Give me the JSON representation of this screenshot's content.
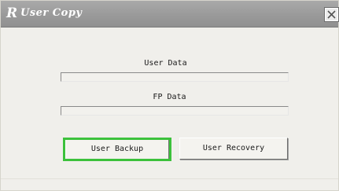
{
  "window": {
    "title": "User Copy",
    "app_icon_glyph": "R",
    "close_glyph": "close-icon"
  },
  "sections": {
    "user_data_label": "User Data",
    "user_data_progress": 0,
    "fp_data_label": "FP Data",
    "fp_data_progress": 0
  },
  "buttons": {
    "backup_label": "User Backup",
    "recovery_label": "User Recovery"
  },
  "colors": {
    "highlight": "#3cc13c",
    "titlebar": "#9a9a9a"
  }
}
